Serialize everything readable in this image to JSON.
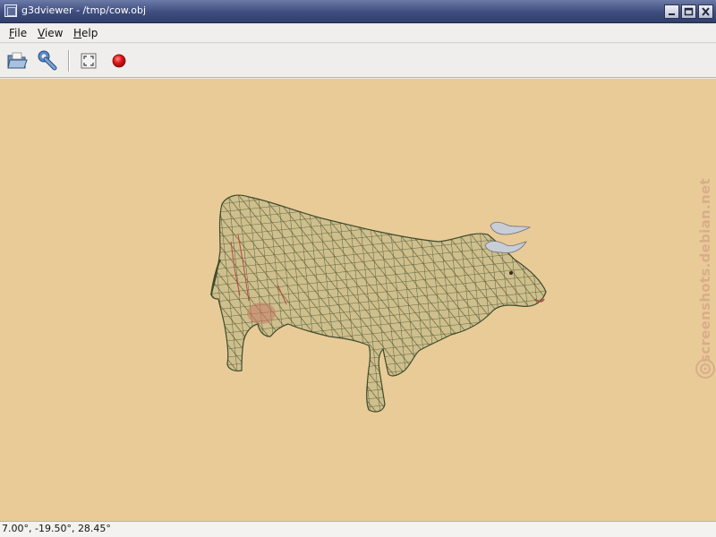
{
  "window": {
    "title": "g3dviewer - /tmp/cow.obj",
    "icon": "window-icon",
    "controls": [
      "minimize-icon",
      "maximize-icon",
      "close-icon"
    ]
  },
  "menubar": {
    "items": [
      {
        "mnemonic": "F",
        "rest": "ile"
      },
      {
        "mnemonic": "V",
        "rest": "iew"
      },
      {
        "mnemonic": "H",
        "rest": "elp"
      }
    ]
  },
  "toolbar": {
    "buttons": [
      "open-file-icon",
      "properties-wrench-icon",
      "fullscreen-icon",
      "record-icon"
    ]
  },
  "viewport": {
    "background_color": "#e9cb98",
    "model": "cow wireframe",
    "wireframe_color": "#3e4b2c",
    "udder_color": "#b74a47",
    "horn_color": "#c9cdd6"
  },
  "watermark": {
    "text": "screenshots.debian.net",
    "color": "#d9ad8a"
  },
  "statusbar": {
    "text": "7.00°, -19.50°, 28.45°"
  }
}
